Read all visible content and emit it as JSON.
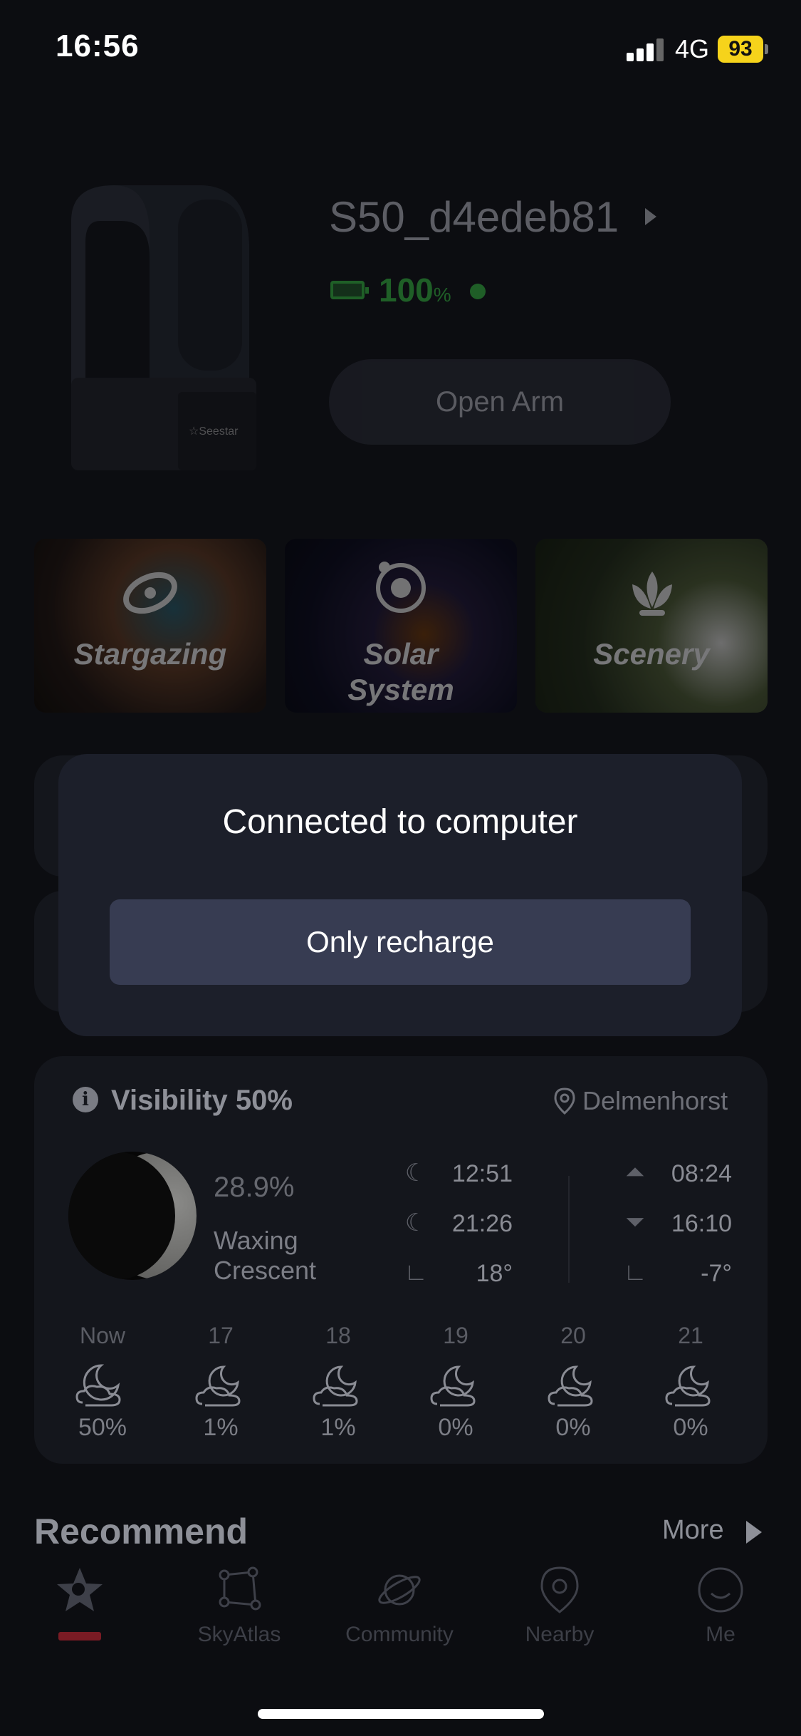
{
  "status_bar": {
    "time": "16:56",
    "network": "4G",
    "battery": "93"
  },
  "device": {
    "name": "S50_d4edeb81",
    "battery_percent": "100",
    "battery_unit": "%",
    "action_button": "Open Arm"
  },
  "modes": [
    {
      "label_line1": "Stargazing",
      "label_line2": ""
    },
    {
      "label_line1": "Solar",
      "label_line2": "System"
    },
    {
      "label_line1": "Scenery",
      "label_line2": ""
    }
  ],
  "popup": {
    "title": "Connected to computer",
    "button": "Only recharge"
  },
  "visibility": {
    "title": "Visibility 50%",
    "location": "Delmenhorst",
    "moon_illumination": "28.9%",
    "moon_phase": "Waxing Crescent",
    "moonrise": "12:51",
    "moonset": "21:26",
    "moon_altitude": "18°",
    "sunrise": "08:24",
    "sunset": "16:10",
    "sun_altitude": "-7°",
    "forecast": [
      {
        "label": "Now",
        "value": "50%",
        "icon": "moon-cloud-icon"
      },
      {
        "label": "17",
        "value": "1%",
        "icon": "cloud-moon-icon"
      },
      {
        "label": "18",
        "value": "1%",
        "icon": "cloud-moon-icon"
      },
      {
        "label": "19",
        "value": "0%",
        "icon": "cloud-moon-icon"
      },
      {
        "label": "20",
        "value": "0%",
        "icon": "cloud-moon-icon"
      },
      {
        "label": "21",
        "value": "0%",
        "icon": "cloud-moon-icon"
      }
    ]
  },
  "recommend": {
    "title": "Recommend",
    "more": "More"
  },
  "tabs": [
    {
      "label": "",
      "icon": "home-star-icon",
      "active": true
    },
    {
      "label": "SkyAtlas",
      "icon": "constellation-icon"
    },
    {
      "label": "Community",
      "icon": "planet-icon"
    },
    {
      "label": "Nearby",
      "icon": "location-pin-icon"
    },
    {
      "label": "Me",
      "icon": "smiley-icon"
    }
  ],
  "colors": {
    "accent_green": "#2fa33a",
    "battery_yellow": "#f6d31b",
    "tab_active": "#7a1b24"
  }
}
